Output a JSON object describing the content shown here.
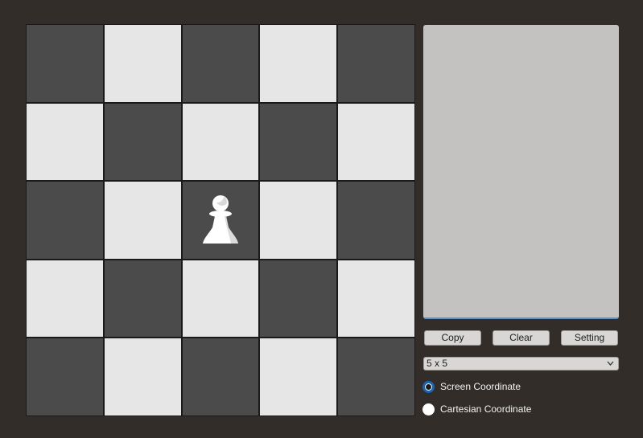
{
  "board": {
    "size_label": "5 x 5",
    "rows": 5,
    "cols": 5,
    "pieces": [
      {
        "row": 2,
        "col": 2,
        "type": "pawn",
        "color": "white",
        "icon": "white-pawn-icon"
      }
    ],
    "colors": {
      "dark": "#4b4b4b",
      "light": "#e6e6e6"
    }
  },
  "output": {
    "text": ""
  },
  "buttons": {
    "copy": "Copy",
    "clear": "Clear",
    "setting": "Setting"
  },
  "size_select": {
    "selected": "5 x 5",
    "icon": "chevron-down-icon"
  },
  "coordinate_mode": {
    "screen_label": "Screen Coordinate",
    "cartesian_label": "Cartesian Coordinate",
    "selected": "screen"
  }
}
